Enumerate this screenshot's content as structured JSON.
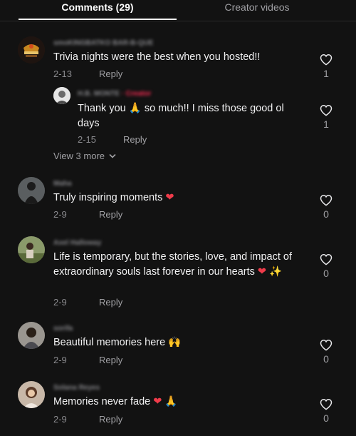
{
  "tabs": [
    {
      "label": "Comments (29)"
    },
    {
      "label": "Creator videos"
    }
  ],
  "comments": [
    {
      "username": "smoKINGBATKO BAR-B-QUE",
      "text": "Trivia nights were the best when you hosted!!",
      "date": "2-13",
      "reply_label": "Reply",
      "likes": "1"
    },
    {
      "username": "H.B. MONTE",
      "creator_tag": "· Creator",
      "text_before": "Thank you",
      "text_emoji": "🙏",
      "text_after": "so much!! I miss those good ol days",
      "date": "2-15",
      "reply_label": "Reply",
      "likes": "1"
    },
    {
      "username": "Maha",
      "text": "Truly inspiring moments",
      "emoji": "❤",
      "date": "2-9",
      "reply_label": "Reply",
      "likes": "0"
    },
    {
      "username": "Axel Halloway",
      "text": "Life is temporary, but the stories, love, and impact of extraordinary souls last forever in our hearts",
      "emoji": "❤",
      "emoji2": "✨",
      "date": "2-9",
      "reply_label": "Reply",
      "likes": "0"
    },
    {
      "username": "sorifa",
      "text": "Beautiful memories here",
      "emoji": "🙌",
      "date": "2-9",
      "reply_label": "Reply",
      "likes": "0"
    },
    {
      "username": "Solana Reyes",
      "text": "Memories never fade",
      "emoji": "❤",
      "emoji2": "🙏",
      "date": "2-9",
      "reply_label": "Reply",
      "likes": "0"
    }
  ],
  "view_more": {
    "label": "View 3 more"
  },
  "colors": {
    "background": "#121212",
    "creator": "#fe2c55",
    "heart_emoji": "#ef3b4a",
    "muted": "#8a8a8e"
  },
  "icons": {
    "like": "heart-outline-icon",
    "expand": "chevron-down-icon"
  }
}
